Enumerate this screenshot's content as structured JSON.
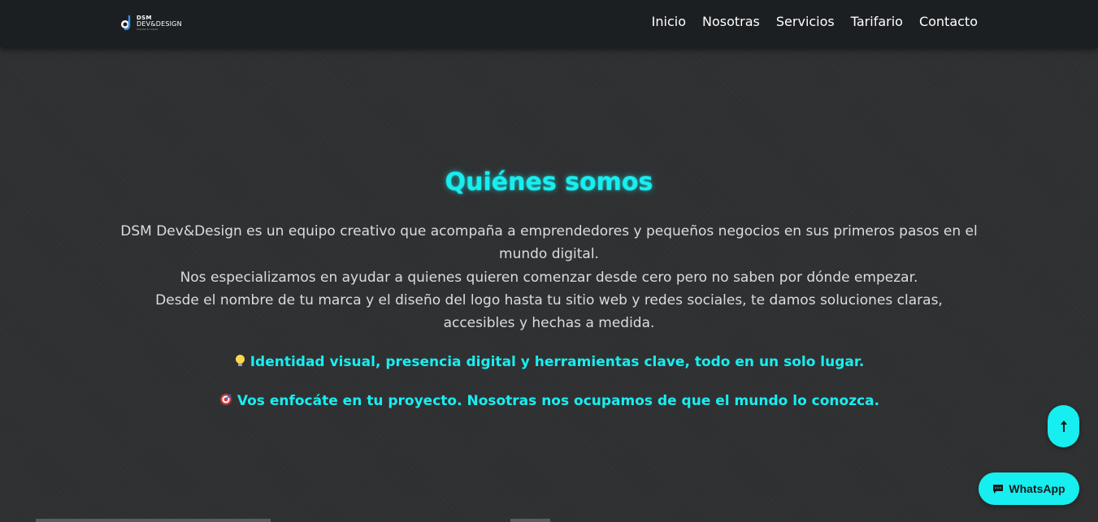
{
  "brand": {
    "line1": "DSM",
    "line2": "DEV&DESIGN",
    "tagline": "Impulsa tu marca"
  },
  "nav": {
    "items": [
      {
        "label": "Inicio"
      },
      {
        "label": "Nosotras"
      },
      {
        "label": "Servicios"
      },
      {
        "label": "Tarifario"
      },
      {
        "label": "Contacto"
      }
    ]
  },
  "about": {
    "title": "Quiénes somos",
    "paragraphs": [
      "DSM Dev&Design es un equipo creativo que acompaña a emprendedores y pequeños negocios en sus primeros pasos en el mundo digital.",
      "Nos especializamos en ayudar a quienes quieren comenzar desde cero pero no saben por dónde empezar.",
      "Desde el nombre de tu marca y el diseño del logo hasta tu sitio web y redes sociales, te damos soluciones claras, accesibles y hechas a medida."
    ],
    "highlights": [
      {
        "icon": "lightbulb-icon",
        "text": "Identidad visual, presencia digital y herramientas clave, todo en un solo lugar."
      },
      {
        "icon": "target-icon",
        "text": "Vos enfocáte en tu proyecto. Nosotras nos ocupamos de que el mundo lo conozca."
      }
    ]
  },
  "floating": {
    "scroll_top_icon": "arrow-up-icon",
    "whatsapp_label": "WhatsApp",
    "whatsapp_icon": "chat-icon"
  },
  "colors": {
    "accent": "#17eef0",
    "background": "#2f3032",
    "navbar": "#1c1f22"
  }
}
